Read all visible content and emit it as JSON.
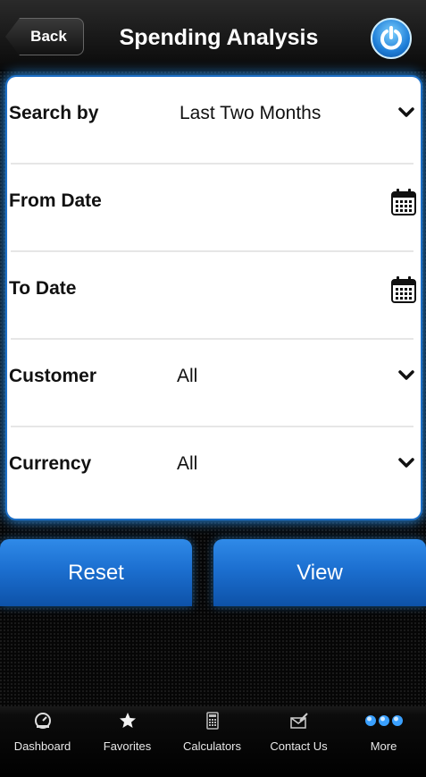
{
  "header": {
    "back_label": "Back",
    "title": "Spending Analysis"
  },
  "form": {
    "search_by": {
      "label": "Search by",
      "value": "Last Two Months"
    },
    "from_date": {
      "label": "From Date"
    },
    "to_date": {
      "label": "To Date"
    },
    "customer": {
      "label": "Customer",
      "value": "All"
    },
    "currency": {
      "label": "Currency",
      "value": "All"
    }
  },
  "actions": {
    "reset_label": "Reset",
    "view_label": "View"
  },
  "tabbar": {
    "items": [
      {
        "label": "Dashboard",
        "icon": "dashboard-icon"
      },
      {
        "label": "Favorites",
        "icon": "star-icon"
      },
      {
        "label": "Calculators",
        "icon": "calculator-icon"
      },
      {
        "label": "Contact Us",
        "icon": "mail-edit-icon"
      },
      {
        "label": "More",
        "icon": "more-dots-icon"
      }
    ]
  },
  "colors": {
    "accent": "#1c6fd0",
    "glow": "#2a8fe8",
    "panel": "#ffffff",
    "background": "#060606"
  }
}
